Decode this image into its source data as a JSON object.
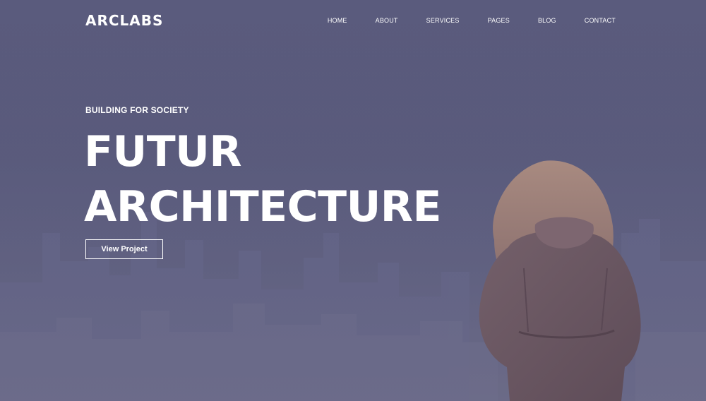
{
  "brand": {
    "logo": "ARCLABS"
  },
  "nav": {
    "items": [
      {
        "label": "HOME"
      },
      {
        "label": "ABOUT"
      },
      {
        "label": "SERVICES"
      },
      {
        "label": "PAGES"
      },
      {
        "label": "BLOG"
      },
      {
        "label": "CONTACT"
      }
    ]
  },
  "hero": {
    "eyebrow": "BUILDING FOR SOCIETY",
    "headline_line1": "FUTUR",
    "headline_line2": "ARCHITECTURE",
    "cta_label": "View Project"
  },
  "colors": {
    "overlay": "#58597b",
    "text": "#ffffff",
    "jacket": "#6d5a63",
    "hair": "#9a8078"
  }
}
